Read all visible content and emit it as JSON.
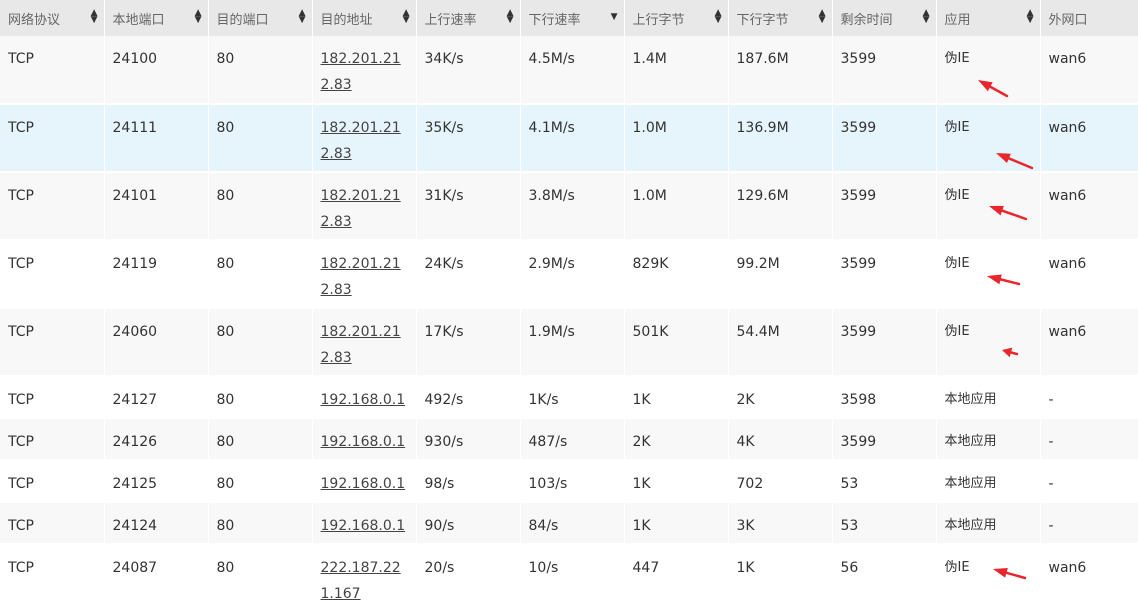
{
  "columns": [
    "网络协议",
    "本地端口",
    "目的端口",
    "目的地址",
    "上行速率",
    "下行速率",
    "上行字节",
    "下行字节",
    "剩余时间",
    "应用",
    "外网口"
  ],
  "rows": [
    {
      "protocol": "TCP",
      "local_port": "24100",
      "dest_port": "80",
      "dest_addr": "182.201.212.83",
      "up_rate": "34K/s",
      "down_rate": "4.5M/s",
      "up_bytes": "1.4M",
      "down_bytes": "187.6M",
      "remaining": "3599",
      "app": "伪IE",
      "wan": "wan6"
    },
    {
      "protocol": "TCP",
      "local_port": "24111",
      "dest_port": "80",
      "dest_addr": "182.201.212.83",
      "up_rate": "35K/s",
      "down_rate": "4.1M/s",
      "up_bytes": "1.0M",
      "down_bytes": "136.9M",
      "remaining": "3599",
      "app": "伪IE",
      "wan": "wan6"
    },
    {
      "protocol": "TCP",
      "local_port": "24101",
      "dest_port": "80",
      "dest_addr": "182.201.212.83",
      "up_rate": "31K/s",
      "down_rate": "3.8M/s",
      "up_bytes": "1.0M",
      "down_bytes": "129.6M",
      "remaining": "3599",
      "app": "伪IE",
      "wan": "wan6"
    },
    {
      "protocol": "TCP",
      "local_port": "24119",
      "dest_port": "80",
      "dest_addr": "182.201.212.83",
      "up_rate": "24K/s",
      "down_rate": "2.9M/s",
      "up_bytes": "829K",
      "down_bytes": "99.2M",
      "remaining": "3599",
      "app": "伪IE",
      "wan": "wan6"
    },
    {
      "protocol": "TCP",
      "local_port": "24060",
      "dest_port": "80",
      "dest_addr": "182.201.212.83",
      "up_rate": "17K/s",
      "down_rate": "1.9M/s",
      "up_bytes": "501K",
      "down_bytes": "54.4M",
      "remaining": "3599",
      "app": "伪IE",
      "wan": "wan6"
    },
    {
      "protocol": "TCP",
      "local_port": "24127",
      "dest_port": "80",
      "dest_addr": "192.168.0.1",
      "up_rate": "492/s",
      "down_rate": "1K/s",
      "up_bytes": "1K",
      "down_bytes": "2K",
      "remaining": "3598",
      "app": "本地应用",
      "wan": "-"
    },
    {
      "protocol": "TCP",
      "local_port": "24126",
      "dest_port": "80",
      "dest_addr": "192.168.0.1",
      "up_rate": "930/s",
      "down_rate": "487/s",
      "up_bytes": "2K",
      "down_bytes": "4K",
      "remaining": "3599",
      "app": "本地应用",
      "wan": "-"
    },
    {
      "protocol": "TCP",
      "local_port": "24125",
      "dest_port": "80",
      "dest_addr": "192.168.0.1",
      "up_rate": "98/s",
      "down_rate": "103/s",
      "up_bytes": "1K",
      "down_bytes": "702",
      "remaining": "53",
      "app": "本地应用",
      "wan": "-"
    },
    {
      "protocol": "TCP",
      "local_port": "24124",
      "dest_port": "80",
      "dest_addr": "192.168.0.1",
      "up_rate": "90/s",
      "down_rate": "84/s",
      "up_bytes": "1K",
      "down_bytes": "3K",
      "remaining": "53",
      "app": "本地应用",
      "wan": "-"
    },
    {
      "protocol": "TCP",
      "local_port": "24087",
      "dest_port": "80",
      "dest_addr": "222.187.221.167",
      "up_rate": "20/s",
      "down_rate": "10/s",
      "up_bytes": "447",
      "down_bytes": "1K",
      "remaining": "56",
      "app": "伪IE",
      "wan": "wan6"
    }
  ],
  "highlighted_row": 1,
  "colors": {
    "header_bg": "#e8e8e8",
    "row_highlight": "#e6f4fb",
    "annotation_arrow": "#e8262b"
  },
  "icons": {
    "sort": "sort-up-down-icon",
    "sort_active": "sort-down-icon",
    "annotation": "red-arrow-icon"
  }
}
